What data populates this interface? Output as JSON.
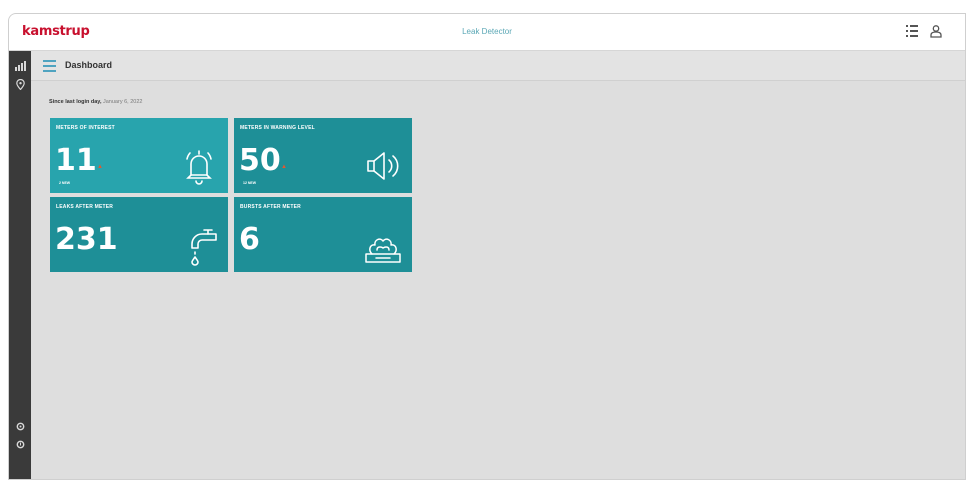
{
  "topbar": {
    "logo": "kamstrup",
    "app_title": "Leak Detector",
    "icons": [
      "grid-icon",
      "user-icon"
    ]
  },
  "sidebar": {
    "icons": [
      "chart-icon",
      "map-pin-icon",
      "settings-icon",
      "logout-icon"
    ]
  },
  "header": {
    "title": "Dashboard"
  },
  "since": {
    "label": "Since last login day,",
    "date": "January 6, 2022"
  },
  "tiles": [
    {
      "title": "METERS OF INTEREST",
      "value": "11",
      "trend": "▲",
      "sub": "2 NEW",
      "icon": "bell-icon"
    },
    {
      "title": "METERS IN WARNING LEVEL",
      "value": "50",
      "trend": "▲",
      "sub": "12 NEW",
      "icon": "speaker-icon"
    },
    {
      "title": "LEAKS AFTER METER",
      "value": "231",
      "trend": "",
      "sub": "",
      "icon": "faucet-drip-icon"
    },
    {
      "title": "BURSTS AFTER METER",
      "value": "6",
      "trend": "",
      "sub": "",
      "icon": "burst-pipe-icon"
    }
  ],
  "colors": {
    "brand": "#c8102e",
    "tile_dark": "#1e8f97",
    "tile_light": "#28a4ad",
    "trend": "#e4572e"
  }
}
